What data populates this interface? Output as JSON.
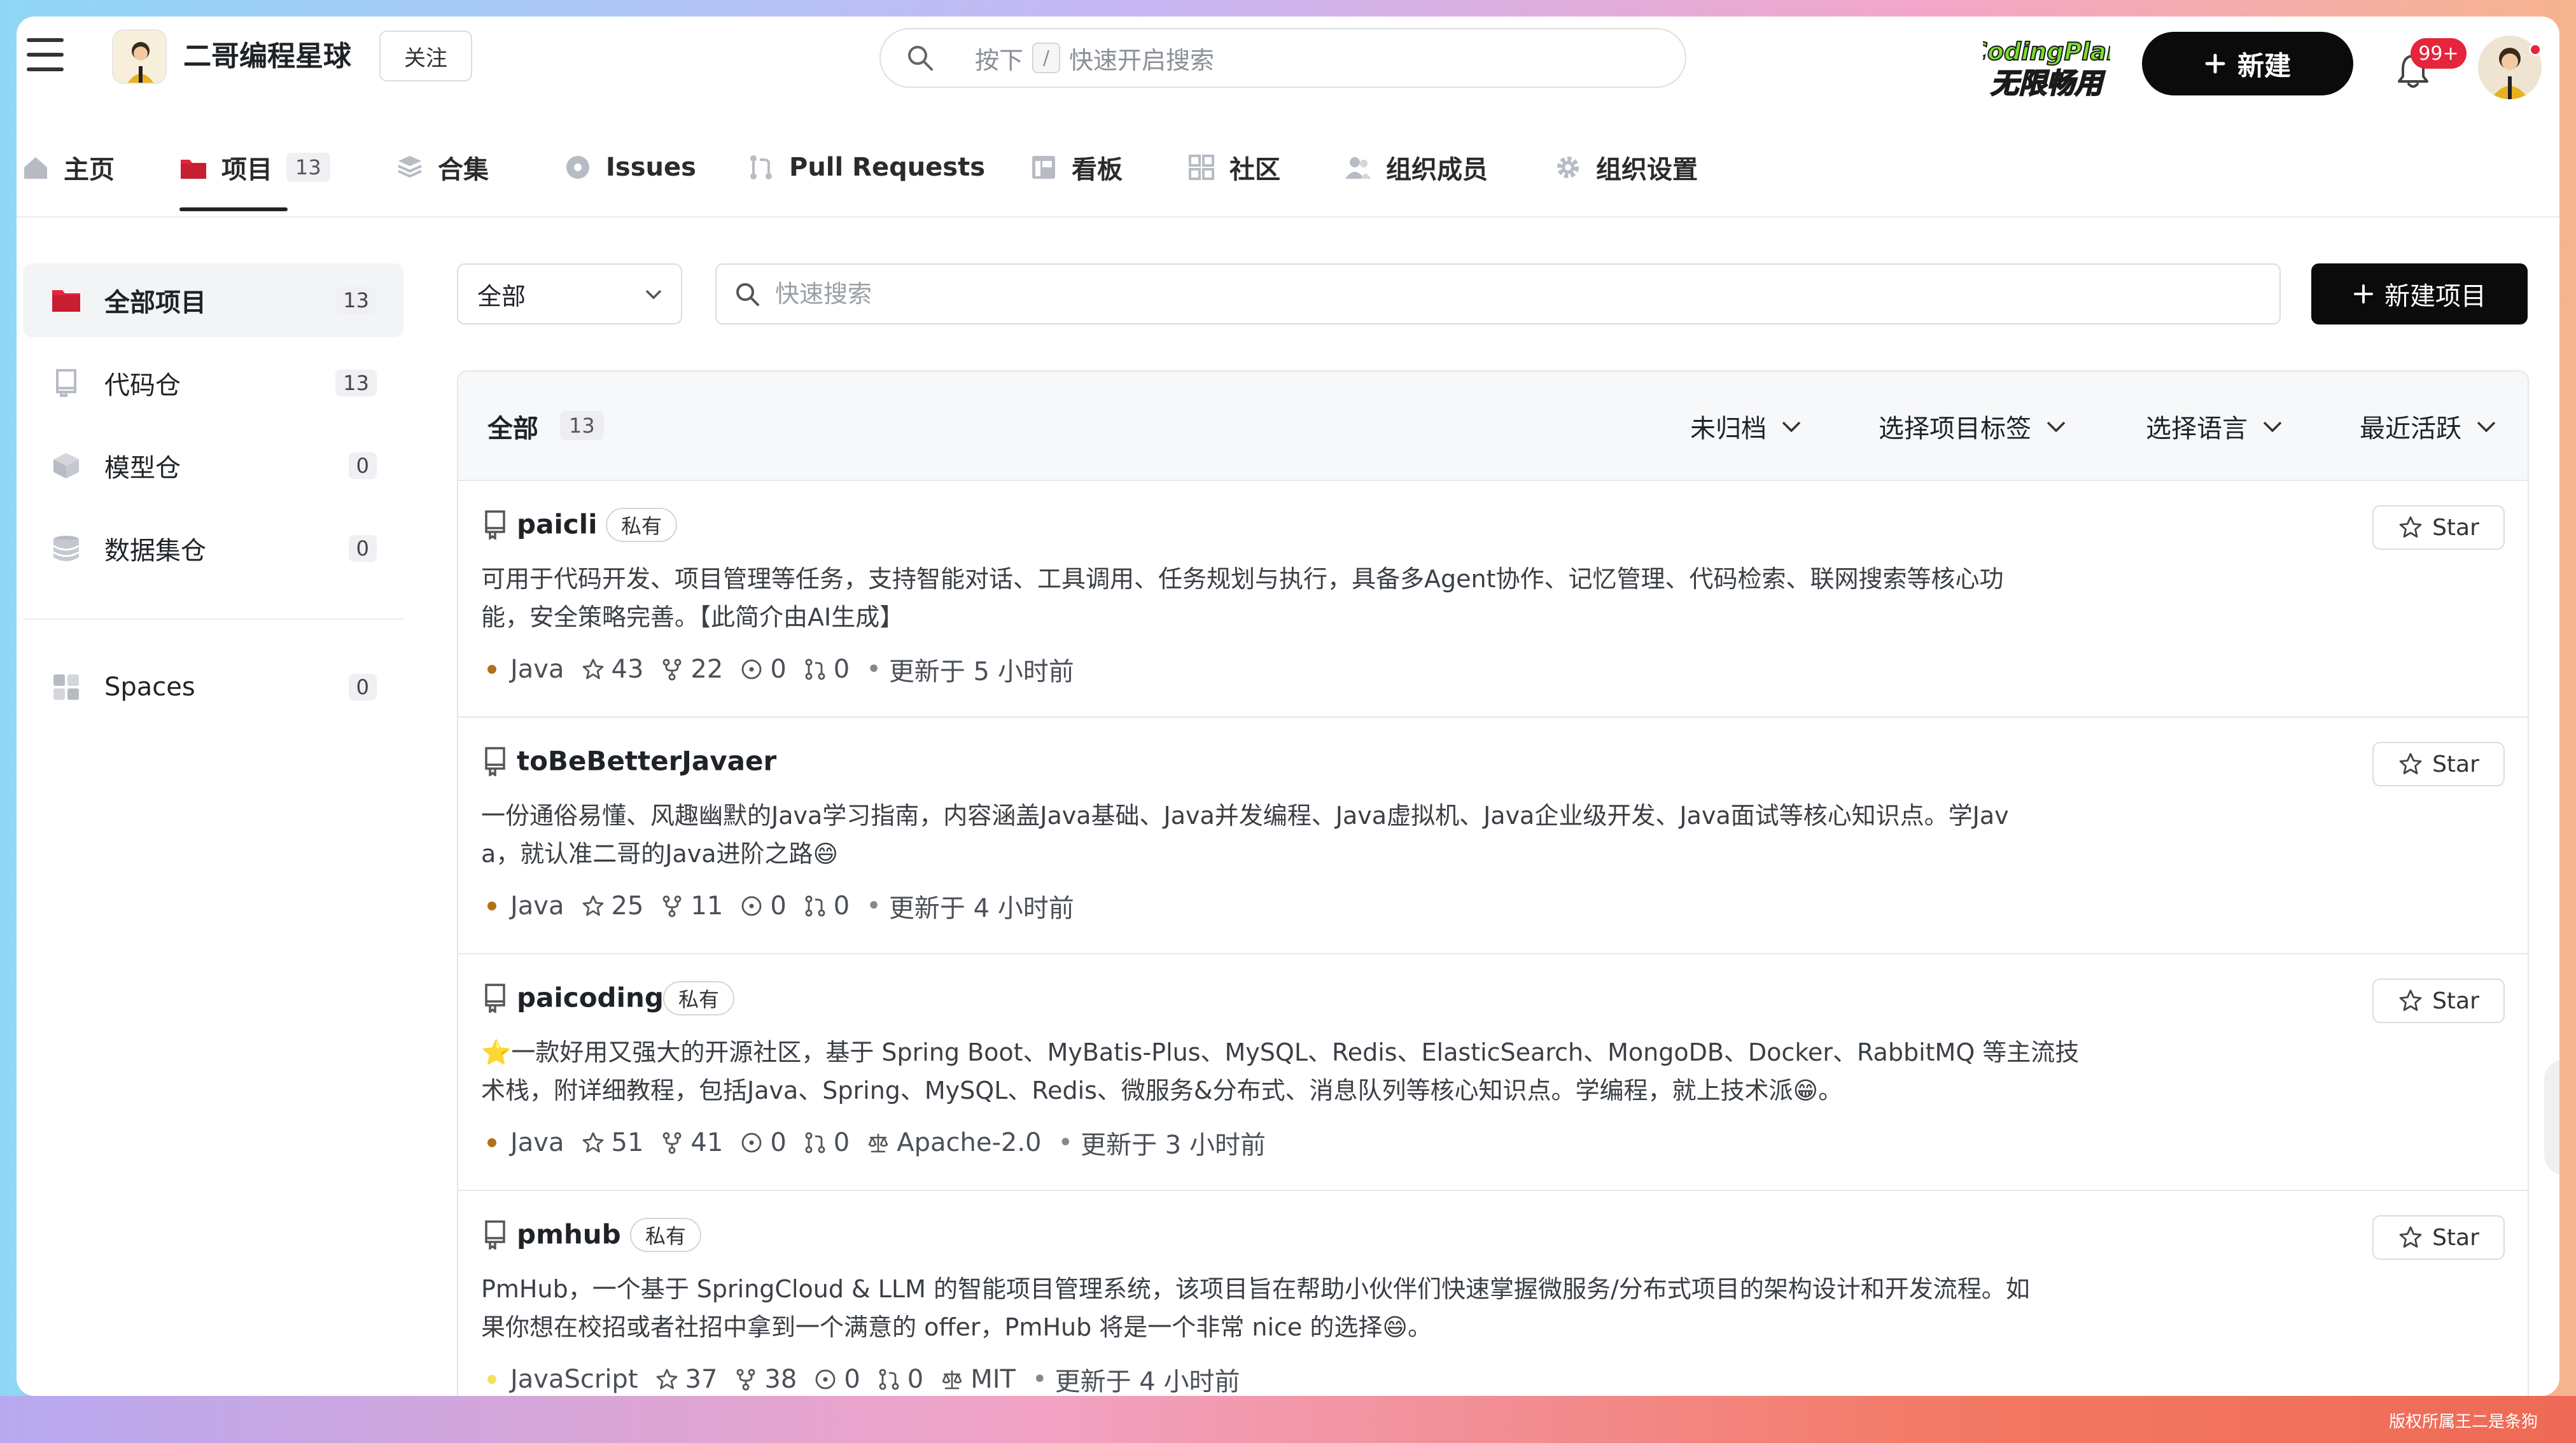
{
  "header": {
    "org_name": "二哥编程星球",
    "follow_label": "关注",
    "search_placeholder_pre": "按下",
    "search_key": "/",
    "search_placeholder_post": "快速开启搜索",
    "promo_line1": "CodingPlan",
    "promo_line2": "无限畅用",
    "new_label": "新建",
    "notification_badge": "99+"
  },
  "tabs": [
    {
      "label": "主页",
      "icon": "home-icon"
    },
    {
      "label": "项目",
      "count": "13",
      "icon": "folder-icon",
      "active": true
    },
    {
      "label": "合集",
      "icon": "layers-icon"
    },
    {
      "label": "Issues",
      "icon": "issue-icon"
    },
    {
      "label": "Pull Requests",
      "icon": "pull-request-icon"
    },
    {
      "label": "看板",
      "icon": "board-icon"
    },
    {
      "label": "社区",
      "icon": "grid-icon"
    },
    {
      "label": "组织成员",
      "icon": "members-icon"
    },
    {
      "label": "组织设置",
      "icon": "gear-icon"
    }
  ],
  "sidebar": {
    "items": [
      {
        "label": "全部项目",
        "count": "13",
        "icon": "folder-icon",
        "active": true
      },
      {
        "label": "代码仓",
        "count": "13",
        "icon": "repo-icon"
      },
      {
        "label": "模型仓",
        "count": "0",
        "icon": "cube-icon"
      },
      {
        "label": "数据集仓",
        "count": "0",
        "icon": "database-icon"
      },
      {
        "label": "Spaces",
        "count": "0",
        "icon": "spaces-icon"
      }
    ]
  },
  "filters": {
    "scope_value": "全部",
    "search_placeholder": "快速搜索",
    "new_project_label": "新建项目"
  },
  "list": {
    "title": "全部",
    "count": "13",
    "dropdowns": [
      "未归档",
      "选择项目标签",
      "选择语言",
      "最近活跃"
    ]
  },
  "repos": [
    {
      "name": "paicli",
      "tag": "私有",
      "desc_line1": "可用于代码开发、项目管理等任务，支持智能对话、工具调用、任务规划与执行，具备多Agent协作、记忆管理、代码检索、联网搜索等核心功",
      "desc_line2": "能，安全策略完善。【此简介由AI生成】",
      "language": "Java",
      "lang_color": "#b07219",
      "stars": "43",
      "forks": "22",
      "issues": "0",
      "prs": "0",
      "license": "",
      "updated": "更新于 5 小时前",
      "star_label": "Star"
    },
    {
      "name": "toBeBetterJavaer",
      "tag": "",
      "desc_line1": "一份通俗易懂、风趣幽默的Java学习指南，内容涵盖Java基础、Java并发编程、Java虚拟机、Java企业级开发、Java面试等核心知识点。学Jav",
      "desc_line2": "a，就认准二哥的Java进阶之路😄",
      "language": "Java",
      "lang_color": "#b07219",
      "stars": "25",
      "forks": "11",
      "issues": "0",
      "prs": "0",
      "license": "",
      "updated": "更新于 4 小时前",
      "star_label": "Star"
    },
    {
      "name": "paicoding",
      "tag": "私有",
      "desc_line1": "⭐️一款好用又强大的开源社区，基于 Spring Boot、MyBatis-Plus、MySQL、Redis、ElasticSearch、MongoDB、Docker、RabbitMQ 等主流技",
      "desc_line2": "术栈，附详细教程，包括Java、Spring、MySQL、Redis、微服务&分布式、消息队列等核心知识点。学编程，就上技术派😁。",
      "language": "Java",
      "lang_color": "#b07219",
      "stars": "51",
      "forks": "41",
      "issues": "0",
      "prs": "0",
      "license": "Apache-2.0",
      "updated": "更新于 3 小时前",
      "star_label": "Star"
    },
    {
      "name": "pmhub",
      "tag": "私有",
      "desc_line1": "PmHub，一个基于 SpringCloud & LLM 的智能项目管理系统，该项目旨在帮助小伙伴们快速掌握微服务/分布式项目的架构设计和开发流程。如",
      "desc_line2": "果你想在校招或者社招中拿到一个满意的 offer，PmHub 将是一个非常 nice 的选择😄。",
      "language": "JavaScript",
      "lang_color": "#f1e05a",
      "stars": "37",
      "forks": "38",
      "issues": "0",
      "prs": "0",
      "license": "MIT",
      "updated": "更新于 4 小时前",
      "star_label": "Star"
    }
  ],
  "footer": {
    "watermark": "版权所属王二是条狗"
  }
}
